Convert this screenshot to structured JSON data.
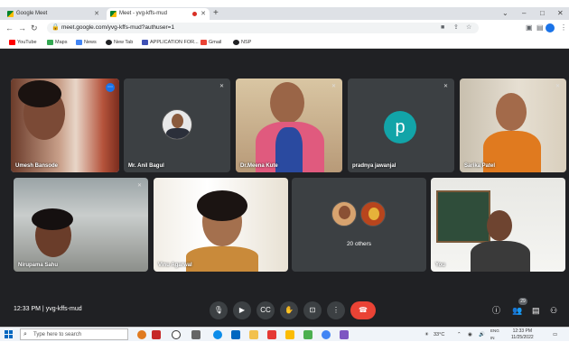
{
  "browser": {
    "tabs": [
      {
        "label": "Google Meet",
        "active": false
      },
      {
        "label": "Meet - yvg-kffs-mud",
        "active": true
      }
    ],
    "new_tab_glyph": "+",
    "window_controls": [
      "⌄",
      "–",
      "□",
      "✕"
    ],
    "url": "meet.google.com/yvg-kffs-mud?authuser=1",
    "profile_letter": "S"
  },
  "bookmarks": [
    {
      "label": "YouTube",
      "color": "#ff0000"
    },
    {
      "label": "Maps",
      "color": "#34a853"
    },
    {
      "label": "News",
      "color": "#4285f4"
    },
    {
      "label": "New Tab",
      "color": "#202124"
    },
    {
      "label": "APPLICATION FOR...",
      "color": "#3f51b5"
    },
    {
      "label": "Gmail",
      "color": "#ea4335"
    },
    {
      "label": "NSP",
      "color": "#202124"
    }
  ],
  "meet": {
    "participants": [
      {
        "name": "Umesh Bansode",
        "type": "video",
        "speaking": true
      },
      {
        "name": "Mr. Anil Bagul",
        "type": "photo"
      },
      {
        "name": "Dr.Meena Kute",
        "type": "video"
      },
      {
        "name": "pradnya jawanjal",
        "type": "avatar",
        "initial": "p",
        "avatar_color": "#12a4a8"
      },
      {
        "name": "Sarika Patel",
        "type": "video"
      },
      {
        "name": "Nirupama Sahu",
        "type": "video"
      },
      {
        "name": "Vinu Agarwal",
        "type": "video"
      },
      {
        "name": "",
        "type": "others"
      },
      {
        "name": "You",
        "type": "video"
      }
    ],
    "others_label": "20 others",
    "meeting_time": "12:33 PM",
    "meeting_code": "yvg-kffs-mud",
    "participant_count": "29",
    "accent_color": "#8ab4f8",
    "end_call_color": "#ea4335"
  },
  "taskbar": {
    "search_placeholder": "Type here to search",
    "weather": "33°C",
    "language": "ENG",
    "region": "IN",
    "time": "12:33 PM",
    "date": "11/25/2022"
  }
}
